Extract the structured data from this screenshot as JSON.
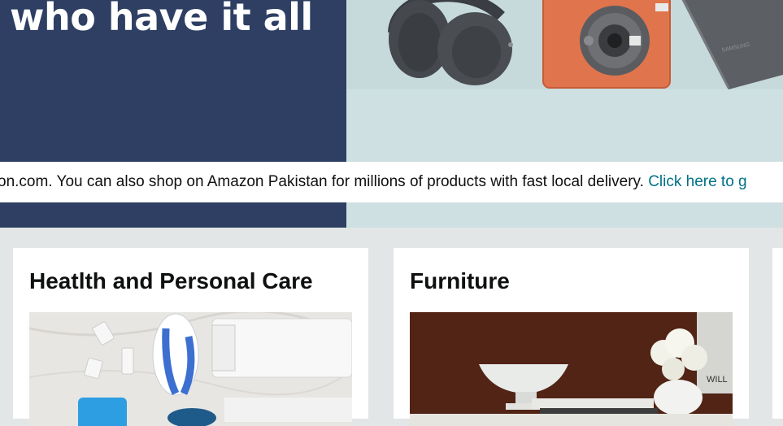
{
  "hero": {
    "headline": "who have it all",
    "banner_text": "on.com. You can also shop on Amazon Pakistan for millions of products with fast local delivery. ",
    "banner_link": "Click here to g"
  },
  "cards": [
    {
      "title": "Heatlth and Personal Care"
    },
    {
      "title": "Furniture"
    }
  ]
}
